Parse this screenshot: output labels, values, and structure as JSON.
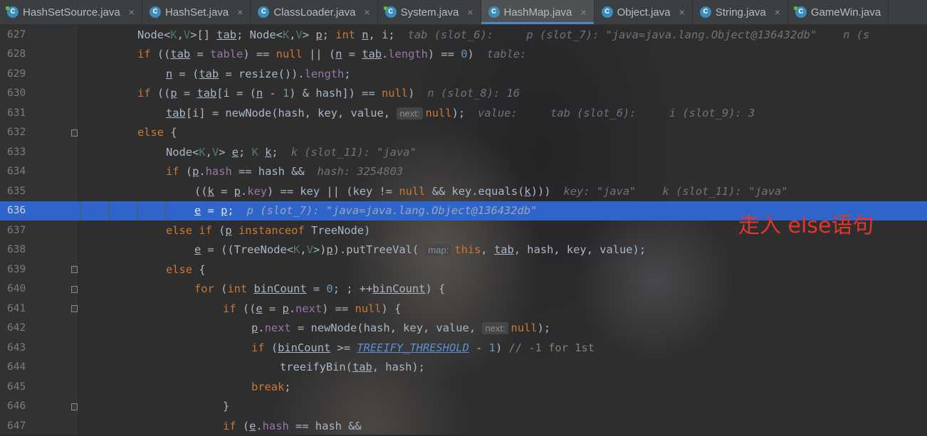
{
  "tabs": [
    {
      "label": "HashSetSource.java",
      "active": false
    },
    {
      "label": "HashSet.java",
      "active": false
    },
    {
      "label": "ClassLoader.java",
      "active": false
    },
    {
      "label": "System.java",
      "active": false
    },
    {
      "label": "HashMap.java",
      "active": true
    },
    {
      "label": "Object.java",
      "active": false
    },
    {
      "label": "String.java",
      "active": false
    },
    {
      "label": "GameWin.java",
      "active": false
    }
  ],
  "close_glyph": "×",
  "line_numbers": [
    "627",
    "628",
    "629",
    "630",
    "631",
    "632",
    "633",
    "634",
    "635",
    "636",
    "637",
    "638",
    "639",
    "640",
    "641",
    "642",
    "643",
    "644",
    "645",
    "646",
    "647"
  ],
  "highlighted_line": "636",
  "hints": {
    "l627": "tab (slot_6):     p (slot_7): \"java=java.lang.Object@136432db\"    n (s",
    "l628": "table:",
    "l630": "n (slot_8): 16",
    "l631": "value:     tab (slot_6):     i (slot_9): 3",
    "l633": "k (slot_11): \"java\"",
    "l634": "hash: 3254803",
    "l635": "key: \"java\"    k (slot_11): \"java\"",
    "l636": "p (slot_7): \"java=java.lang.Object@136432db\""
  },
  "param_hints": {
    "next": "next:",
    "map": "map:"
  },
  "annotation": "走入 else语句",
  "colors": {
    "keyword": "#cc7832",
    "field": "#9876aa",
    "number": "#6897bb",
    "highlight": "#2f65ca",
    "annotation": "#e0362b"
  }
}
